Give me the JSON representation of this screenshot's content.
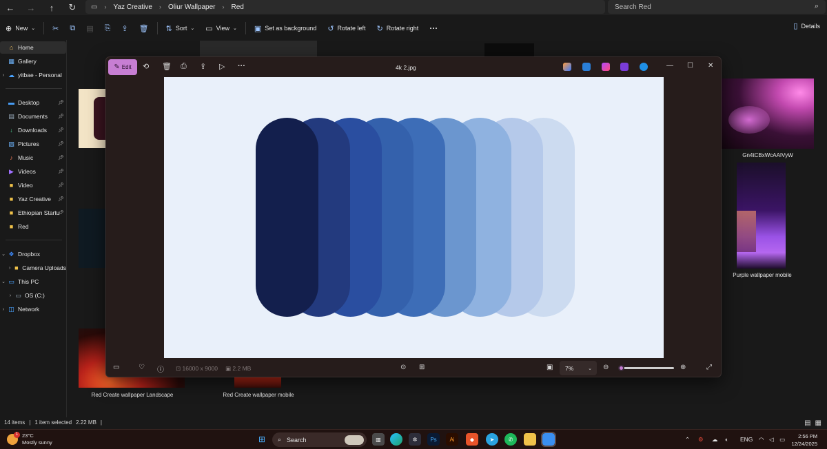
{
  "explorer": {
    "breadcrumbs": [
      "Yaz Creative",
      "Oliur Wallpaper",
      "Red"
    ],
    "search_placeholder": "Search Red",
    "toolbar": {
      "new_label": "New",
      "sort_label": "Sort",
      "view_label": "View",
      "set_background_label": "Set as background",
      "rotate_left_label": "Rotate left",
      "rotate_right_label": "Rotate right",
      "more_label": "···",
      "details_label": "Details"
    },
    "sidebar": {
      "items": [
        {
          "label": "Home",
          "icon": "home-icon"
        },
        {
          "label": "Gallery",
          "icon": "gallery-icon"
        },
        {
          "label": "yitbae - Personal",
          "icon": "onedrive-icon"
        },
        {
          "label": "Desktop",
          "icon": "desktop-icon"
        },
        {
          "label": "Documents",
          "icon": "documents-icon"
        },
        {
          "label": "Downloads",
          "icon": "downloads-icon"
        },
        {
          "label": "Pictures",
          "icon": "pictures-icon"
        },
        {
          "label": "Music",
          "icon": "music-icon"
        },
        {
          "label": "Videos",
          "icon": "videos-icon"
        },
        {
          "label": "Video",
          "icon": "folder-icon"
        },
        {
          "label": "Yaz Creative",
          "icon": "folder-icon"
        },
        {
          "label": "Ethiopian Startu",
          "icon": "folder-icon"
        },
        {
          "label": "Red",
          "icon": "folder-icon"
        },
        {
          "label": "Dropbox",
          "icon": "dropbox-icon"
        },
        {
          "label": "Camera Uploads",
          "icon": "folder-icon"
        },
        {
          "label": "This PC",
          "icon": "pc-icon"
        },
        {
          "label": "OS (C:)",
          "icon": "drive-icon"
        },
        {
          "label": "Network",
          "icon": "network-icon"
        }
      ]
    },
    "files": [
      {
        "label": "Gn4tCBxWcAAIVyW"
      },
      {
        "label": "Purple wallpaper mobile"
      },
      {
        "label": "Red Create wallpaper Landscape"
      },
      {
        "label": "Red Create wallpaper mobile"
      }
    ],
    "status": {
      "items_count": "14 items",
      "selection": "1 item selected",
      "size": "2.22 MB"
    }
  },
  "viewer": {
    "edit_label": "Edit",
    "title": "4k 2.jpg",
    "dimensions": "16000 x 9000",
    "file_size": "2.2 MB",
    "zoom_value": "7%",
    "zoom_fraction": 0.07,
    "image_pills": [
      {
        "color": "#131f4d"
      },
      {
        "color": "#233a7e"
      },
      {
        "color": "#2a4ea0"
      },
      {
        "color": "#3461ac"
      },
      {
        "color": "#3d6db7"
      },
      {
        "color": "#6b96cf"
      },
      {
        "color": "#8fb2e0"
      },
      {
        "color": "#b5c9ea"
      },
      {
        "color": "#ccdbf0"
      }
    ]
  },
  "taskbar": {
    "weather_temp": "23°C",
    "weather_desc": "Mostly sunny",
    "search_label": "Search",
    "language": "ENG",
    "time": "2:56 PM",
    "date": "12/24/2025",
    "apps": [
      "start-icon",
      "search-icon",
      "widgets-icon",
      "task-view-icon",
      "edge-icon",
      "davinci-icon",
      "photoshop-icon",
      "illustrator-icon",
      "brave-icon",
      "telegram-icon",
      "whatsapp-icon",
      "file-explorer-icon",
      "photos-icon"
    ]
  }
}
